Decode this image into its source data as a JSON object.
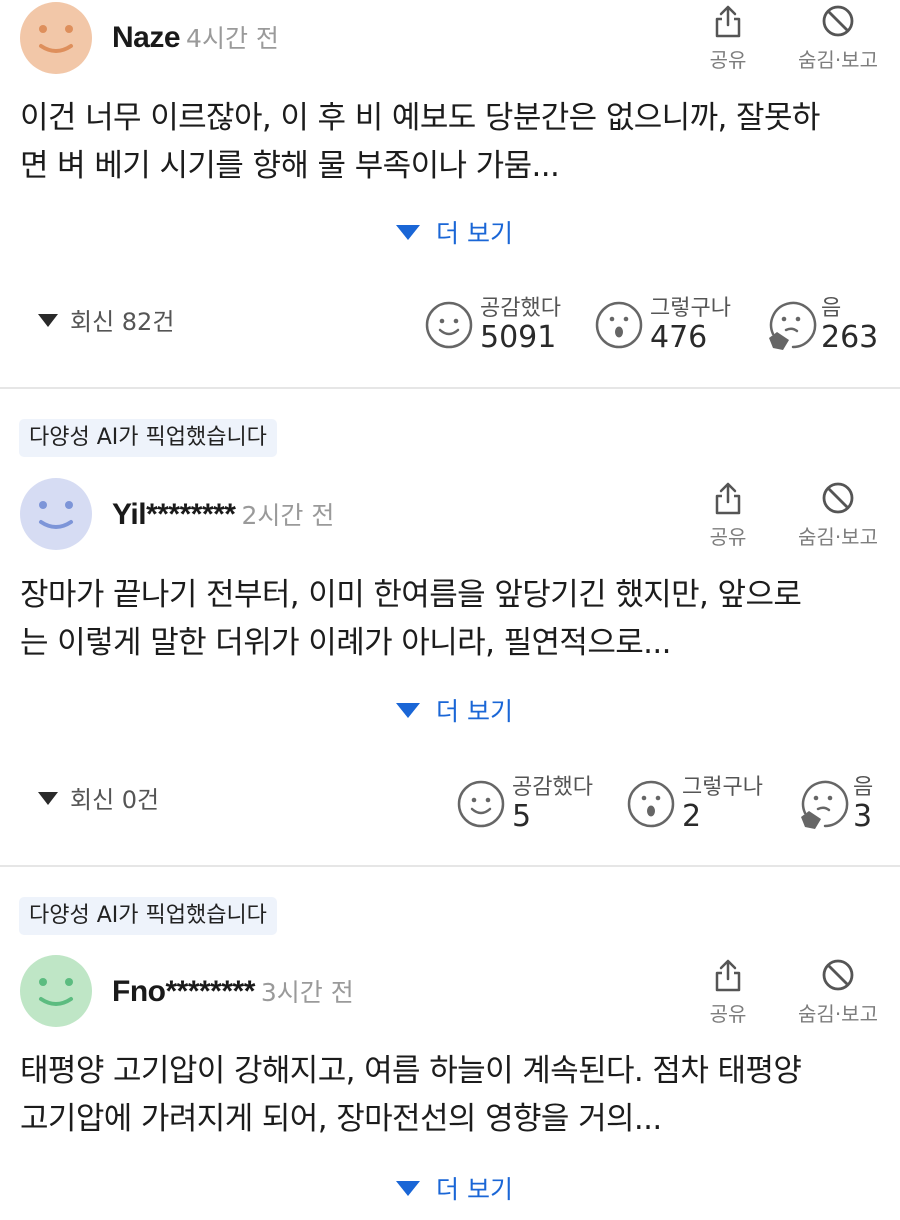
{
  "actions": {
    "share_label": "공유",
    "hide_report_label": "숨김·보고"
  },
  "more_label": "더 보기",
  "colors": {
    "accent": "#1a66d6",
    "divider": "#e6e6e6",
    "pickup_bg": "#eef3fb"
  },
  "comments": [
    {
      "avatar_color": "#f2c7a8",
      "avatar_face_color": "#de8f5c",
      "author": "Naze",
      "time": "4시간 전",
      "body_lines": [
        "이건 너무 이르잖아, 이 후 비 예보도 당분간은 없으니까, 잘못하",
        "면 벼 베기 시기를 향해 물 부족이나 가뭄..."
      ],
      "replies": "회신 82건",
      "reactions": [
        {
          "icon": "smile-icon",
          "label": "공감했다",
          "count": "5091"
        },
        {
          "icon": "surprised-icon",
          "label": "그렇구나",
          "count": "476"
        },
        {
          "icon": "thinking-icon",
          "label": "음",
          "count": "263"
        }
      ]
    },
    {
      "pickup": "다양성 AI가 픽업했습니다",
      "avatar_color": "#d6dcf3",
      "avatar_face_color": "#7d95d8",
      "author": "Yil********",
      "time": "2시간 전",
      "body_lines": [
        "장마가 끝나기 전부터, 이미 한여름을 앞당기긴 했지만, 앞으로",
        "는 이렇게 말한 더위가 이례가 아니라, 필연적으로..."
      ],
      "replies": "회신 0건",
      "reactions": [
        {
          "icon": "smile-icon",
          "label": "공감했다",
          "count": "5"
        },
        {
          "icon": "surprised-icon",
          "label": "그렇구나",
          "count": "2"
        },
        {
          "icon": "thinking-icon",
          "label": "음",
          "count": "3"
        }
      ]
    },
    {
      "pickup": "다양성 AI가 픽업했습니다",
      "avatar_color": "#bfe6c6",
      "avatar_face_color": "#5cbc80",
      "author": "Fno********",
      "time": "3시간 전",
      "body_lines": [
        "태평양 고기압이 강해지고, 여름 하늘이 계속된다. 점차 태평양",
        "고기압에 가려지게 되어, 장마전선의 영향을 거의..."
      ]
    }
  ]
}
